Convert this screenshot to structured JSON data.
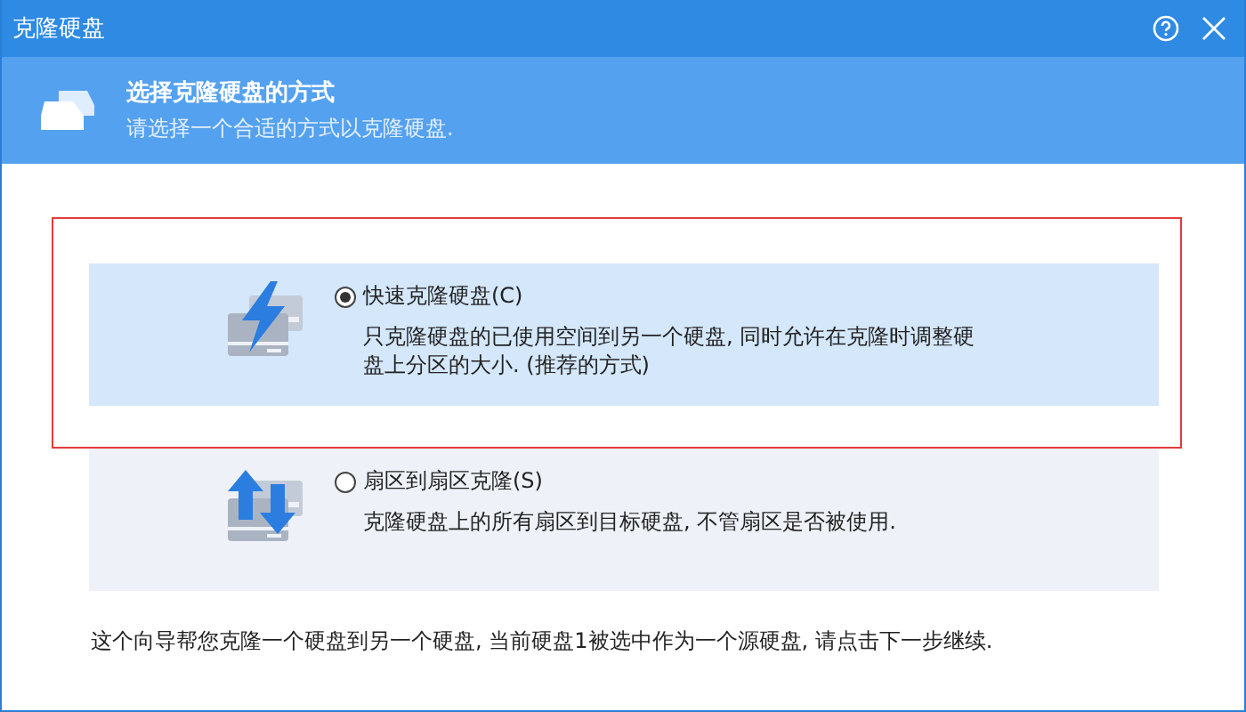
{
  "window": {
    "title": "克隆硬盘"
  },
  "header": {
    "title": "选择克隆硬盘的方式",
    "subtitle": "请选择一个合适的方式以克隆硬盘."
  },
  "options": [
    {
      "kind": "fast",
      "label": "快速克隆硬盘(C)",
      "description": "只克隆硬盘的已使用空间到另一个硬盘, 同时允许在克隆时调整硬盘上分区的大小. (推荐的方式)",
      "selected": true,
      "highlighted": true
    },
    {
      "kind": "sector",
      "label": "扇区到扇区克隆(S)",
      "description": "克隆硬盘上的所有扇区到目标硬盘, 不管扇区是否被使用.",
      "selected": false,
      "highlighted": false
    }
  ],
  "footer": "这个向导帮您克隆一个硬盘到另一个硬盘, 当前硬盘1被选中作为一个源硬盘, 请点击下一步继续."
}
